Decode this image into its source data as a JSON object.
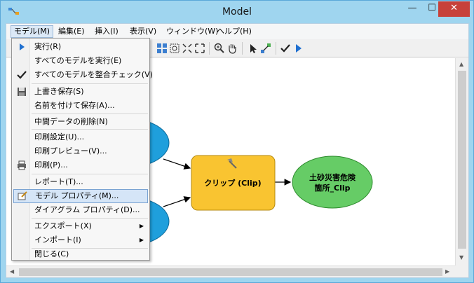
{
  "window": {
    "title": "Model",
    "controls": {
      "minimize": "—",
      "maximize": "☐",
      "close": "✕"
    }
  },
  "menubar": [
    {
      "label": "モデル(M)"
    },
    {
      "label": "編集(E)"
    },
    {
      "label": "挿入(I)"
    },
    {
      "label": "表示(V)"
    },
    {
      "label": "ウィンドウ(W)"
    },
    {
      "label": "ヘルプ(H)"
    }
  ],
  "dropdown": {
    "items": [
      {
        "label": "実行(R)"
      },
      {
        "label": "すべてのモデルを実行(E)"
      },
      {
        "label": "すべてのモデルを整合チェック(V)"
      },
      {
        "label": "上書き保存(S)"
      },
      {
        "label": "名前を付けて保存(A)..."
      },
      {
        "label": "中間データの削除(N)"
      },
      {
        "label": "印刷設定(U)..."
      },
      {
        "label": "印刷プレビュー(V)..."
      },
      {
        "label": "印刷(P)..."
      },
      {
        "label": "レポート(T)..."
      },
      {
        "label": "モデル プロパティ(M)..."
      },
      {
        "label": "ダイアグラム プロパティ(D)..."
      },
      {
        "label": "エクスポート(X)"
      },
      {
        "label": "インポート(I)"
      },
      {
        "label": "閉じる(C)"
      }
    ],
    "highlighted": "モデル プロパティ(M)..."
  },
  "diagram": {
    "tool_node": {
      "label": "クリップ (Clip)",
      "color": "#f9c431"
    },
    "output_node": {
      "line1": "土砂災害危険",
      "line2": "箇所_Clip",
      "color": "#66cc66"
    },
    "input_color": "#1f9fdc"
  }
}
